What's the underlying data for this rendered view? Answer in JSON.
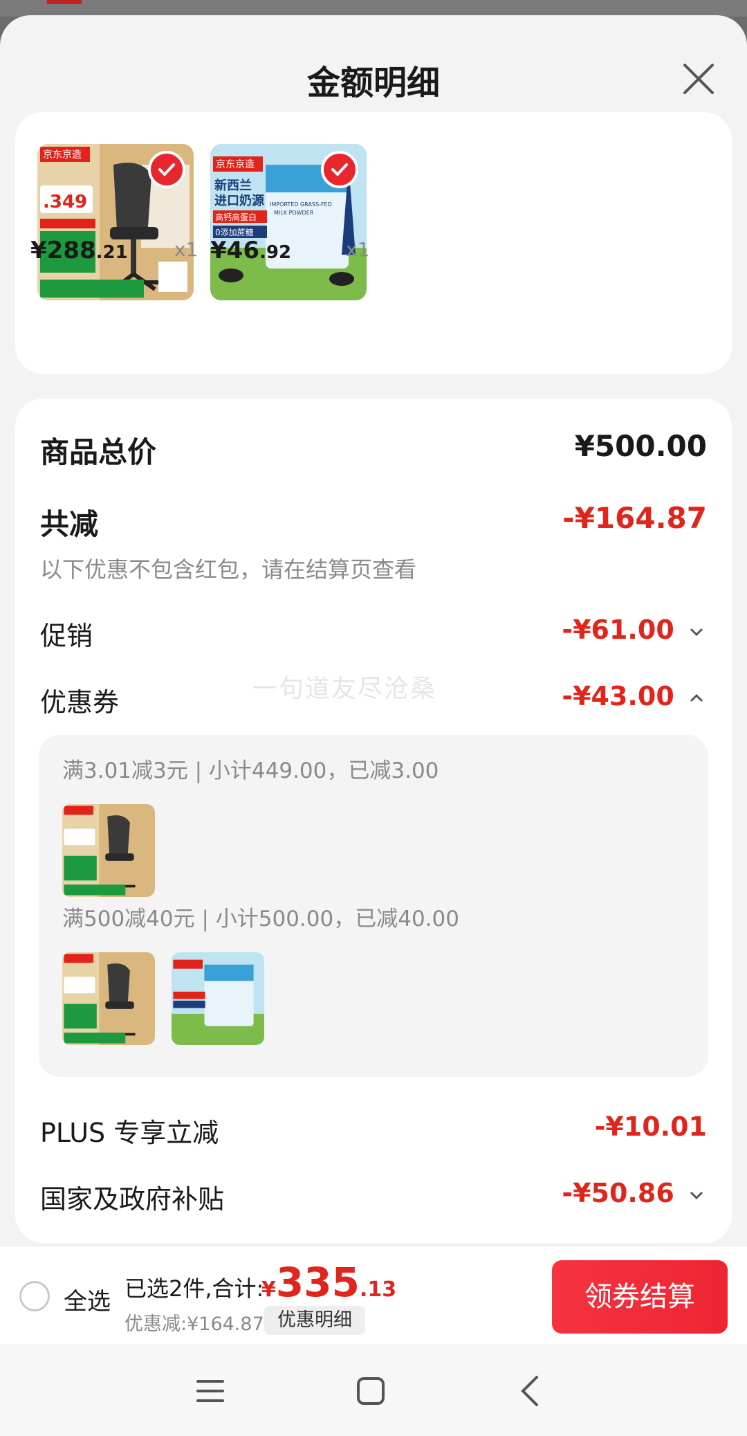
{
  "header": {
    "title": "金额明细",
    "close_icon": "close-icon"
  },
  "products": [
    {
      "price_int": "¥288",
      "price_dec": ".21",
      "qty": "x1",
      "icon": "office-chair-image",
      "checked": true
    },
    {
      "price_int": "¥46",
      "price_dec": ".92",
      "qty": "x1",
      "icon": "milk-powder-image",
      "checked": true
    }
  ],
  "chair_image_text": {
    "brand": "京东京造",
    "price": ".349"
  },
  "milk_image_text": {
    "brand": "京东京造",
    "line1": "新西兰",
    "line2": "进口奶源",
    "tag1": "高钙高蛋白",
    "tag2": "0添加蔗糖",
    "pack1": "IMPORTED GRASS-FED",
    "pack2": "MILK POWDER"
  },
  "summary": {
    "total_label": "商品总价",
    "total_value": "¥500.00",
    "reduce_label": "共减",
    "reduce_value": "-¥164.87",
    "note": "以下优惠不包含红包，请在结算页查看",
    "promo_label": "促销",
    "promo_value": "-¥61.00",
    "coupon_label": "优惠券",
    "coupon_value": "-¥43.00",
    "coupon_lines": [
      "满3.01减3元 | 小计449.00，已减3.00",
      "满500减40元 | 小计500.00，已减40.00"
    ],
    "plus_label": "PLUS 专享立减",
    "plus_value": "-¥10.01",
    "gov_label": "国家及政府补贴",
    "gov_value": "-¥50.86"
  },
  "watermark": "一句道友尽沧桑",
  "bottom": {
    "select_all": "全选",
    "selected_text": "已选2件,合计:",
    "total_currency": "¥",
    "total_int": "335",
    "total_dec": ".13",
    "discount_text": "优惠减:¥164.87",
    "detail_button": "优惠明细",
    "checkout_button": "领券结算"
  },
  "colors": {
    "accent_red": "#e0251c",
    "button_red": "#f5333f",
    "background": "#f3f3f3"
  }
}
